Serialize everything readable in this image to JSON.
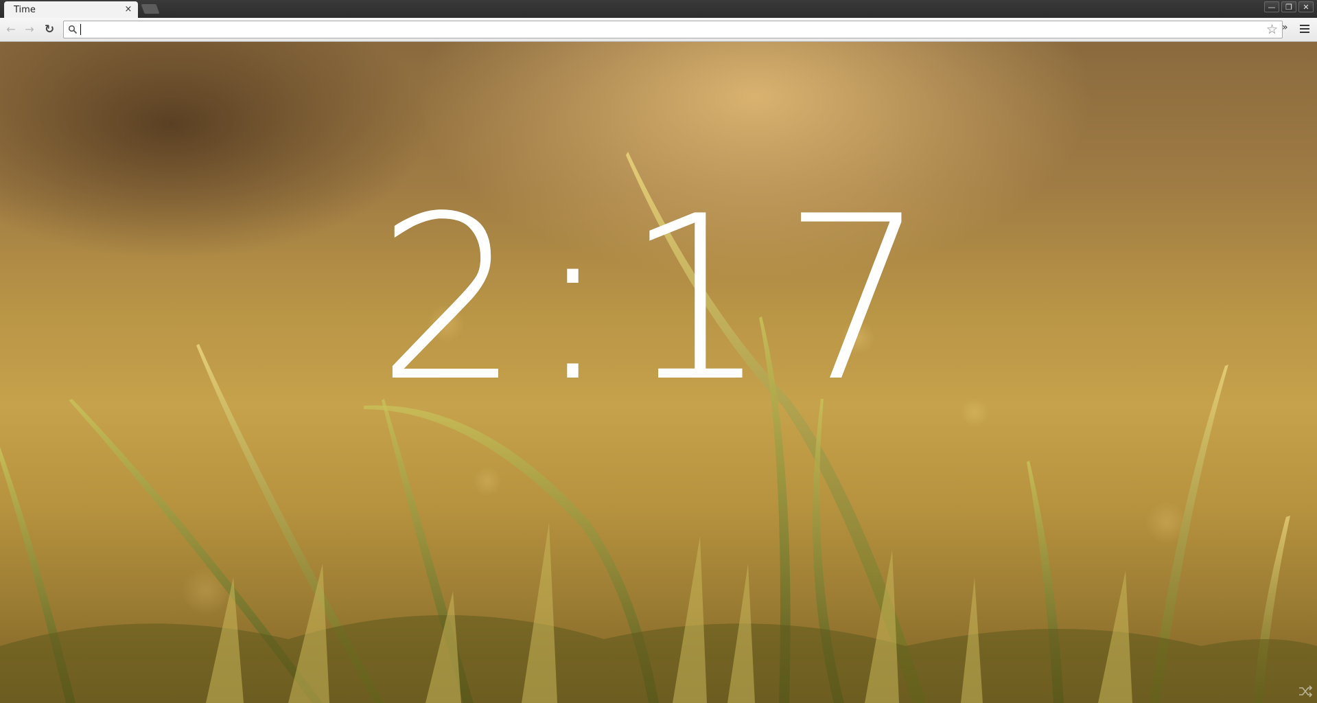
{
  "browser": {
    "tab": {
      "title": "Time",
      "close_glyph": "×"
    },
    "window_controls": {
      "minimize_glyph": "—",
      "maximize_glyph": "❐",
      "close_glyph": "✕"
    },
    "toolbar": {
      "back_glyph": "←",
      "forward_glyph": "→",
      "reload_glyph": "↻",
      "star_glyph": "☆",
      "overflow_glyph": "»"
    },
    "omnibox": {
      "value": "",
      "icon": "search-icon"
    }
  },
  "page": {
    "clock": {
      "time": "2:17"
    },
    "background": "grass-photo",
    "corner_icon": "shuffle-icon"
  },
  "colors": {
    "clock_text": "#ffffff",
    "tabstrip": "#2c2c2c",
    "toolbar": "#eeeeee"
  }
}
